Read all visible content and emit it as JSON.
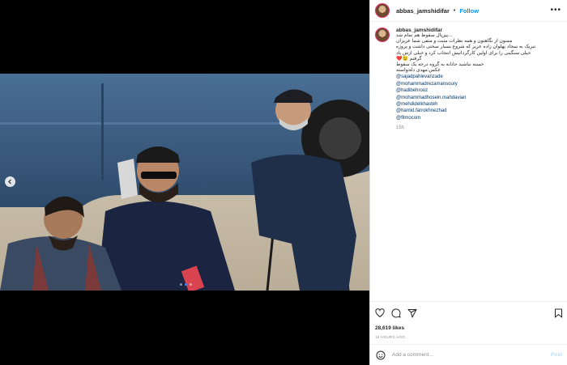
{
  "header": {
    "username": "abbas_jamshidifar",
    "separator": "•",
    "follow_label": "Follow",
    "more_glyph": "•••"
  },
  "caption": {
    "username": "abbas_jamshidifar",
    "lines": [
      "...پیرپال سقوط هم تمام شد",
      "ممنون از نگاهتون و همه نظرات مثبت و منفی شما عزیزان",
      "تبریک به سجاد پهلوان زاده عزیز که شروع بسیار سختی داشت و پروژه",
      "خیلی سنگینی را برای اولین کارگردانیش انتخاب کرد و خیلی ازش یاد",
      "گرفتم 😉❤️",
      "خسته نباشید جانانه به گروه درجه یک سقوط",
      "عکس:مهدی دلخواسته"
    ],
    "mentions": [
      "@sajadpahlevanzade",
      "@mohammadrezamansoury",
      "@hadibehrooz",
      "@mohammadhosein.mahdavian",
      "@mehdidelkhasteh",
      "@hamid.farrokhnezhad",
      "@filmocom"
    ],
    "time": "15h"
  },
  "actions": {
    "likes": "28,619 likes",
    "date": "15 HOURS AGO",
    "icons": [
      "heart-icon",
      "comment-icon",
      "share-icon",
      "bookmark-icon"
    ]
  },
  "add_comment": {
    "placeholder": "Add a comment...",
    "post_label": "Post"
  },
  "carousel": {
    "active_index": 0,
    "count": 3
  },
  "colors": {
    "accent": "#0095f6",
    "mention": "#00376b",
    "muted": "#8e8e8e",
    "ring": "#e1306c"
  }
}
